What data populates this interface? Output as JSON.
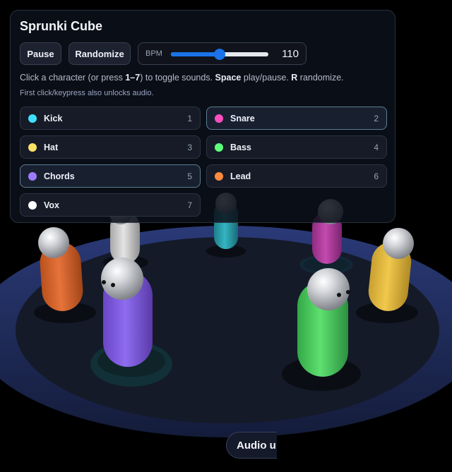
{
  "app": {
    "title": "Sprunki Cube",
    "pause_label": "Pause",
    "randomize_label": "Randomize",
    "bpm_label": "BPM",
    "bpm_value": "110",
    "bpm_slider": {
      "min": 60,
      "max": 160,
      "value": 110
    },
    "help": {
      "part1": "Click a character (or press ",
      "keys": "1–7",
      "part2": ") to toggle sounds. ",
      "space": "Space",
      "part3": " play/pause. ",
      "r": "R",
      "part4": " randomize."
    },
    "note": "First click/keypress also unlocks audio."
  },
  "channels": [
    {
      "name": "Kick",
      "key": "1",
      "color": "#3fe0ff",
      "active": false
    },
    {
      "name": "Snare",
      "key": "2",
      "color": "#ff4fbf",
      "active": true
    },
    {
      "name": "Hat",
      "key": "3",
      "color": "#ffe066",
      "active": false
    },
    {
      "name": "Bass",
      "key": "4",
      "color": "#5dff7a",
      "active": false
    },
    {
      "name": "Chords",
      "key": "5",
      "color": "#9b7cff",
      "active": true
    },
    {
      "name": "Lead",
      "key": "6",
      "color": "#ff8a3d",
      "active": false
    },
    {
      "name": "Vox",
      "key": "7",
      "color": "#ffffff",
      "active": false
    }
  ],
  "audio_button": "Audio u",
  "scene_colors": {
    "platform": "#1e2a55",
    "platform_inner": "#141b2c",
    "kick_body": "#2a9aa6",
    "snare_body": "#b43fa0",
    "hat_body": "#e0b63c",
    "bass_body": "#46c85a",
    "chords_body": "#7a5ad6",
    "lead_body": "#d8652a",
    "vox_body": "#c8c8c8"
  }
}
